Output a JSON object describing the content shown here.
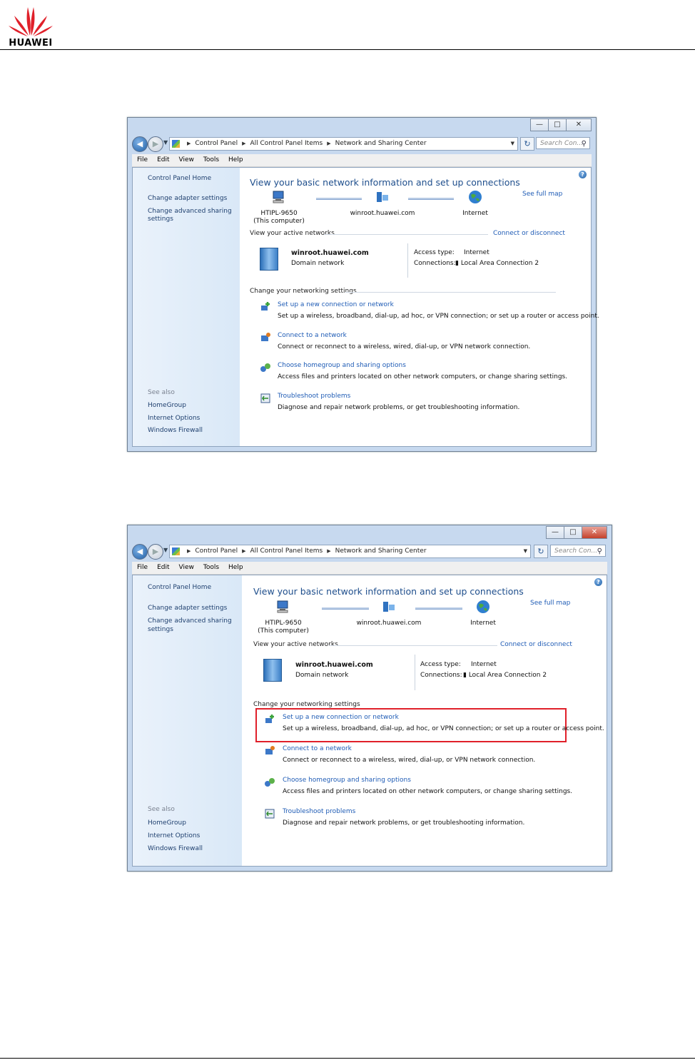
{
  "brand": {
    "name": "HUAWEI",
    "logo_color": "#e0202a"
  },
  "windows": [
    {
      "titlebar": {
        "buttons": [
          "minimize",
          "maximize",
          "close"
        ]
      },
      "address": {
        "crumbs": [
          "Control Panel",
          "All Control Panel Items",
          "Network and Sharing Center"
        ],
        "search_placeholder": "Search Con..."
      },
      "menu": [
        "File",
        "Edit",
        "View",
        "Tools",
        "Help"
      ],
      "sidebar": {
        "home": "Control Panel Home",
        "adapter": "Change adapter settings",
        "sharing_1": "Change advanced sharing",
        "sharing_2": "settings",
        "see_also": "See also",
        "links": [
          "HomeGroup",
          "Internet Options",
          "Windows Firewall"
        ]
      },
      "main": {
        "title": "View your basic network information and set up connections",
        "see_full_map": "See full map",
        "nodes": [
          {
            "name": "HTIPL-9650",
            "sub": "(This computer)",
            "icon": "computer-icon"
          },
          {
            "name": "winroot.huawei.com",
            "sub": "",
            "icon": "domain-icon"
          },
          {
            "name": "Internet",
            "sub": "",
            "icon": "globe-icon"
          }
        ],
        "active_networks_label": "View your active networks",
        "connect_disconnect": "Connect or disconnect",
        "network": {
          "name": "winroot.huawei.com",
          "type": "Domain network",
          "access_label": "Access type:",
          "access_value": "Internet",
          "connections_label": "Connections:",
          "connections_value": "Local Area Connection 2"
        },
        "change_settings_label": "Change your networking settings",
        "tasks": [
          {
            "title": "Set up a new connection or network",
            "desc": "Set up a wireless, broadband, dial-up, ad hoc, or VPN connection; or set up a router or access point."
          },
          {
            "title": "Connect to a network",
            "desc": "Connect or reconnect to a wireless, wired, dial-up, or VPN network connection."
          },
          {
            "title": "Choose homegroup and sharing options",
            "desc": "Access files and printers located on other network computers, or change sharing settings."
          },
          {
            "title": "Troubleshoot problems",
            "desc": "Diagnose and repair network problems, or get troubleshooting information."
          }
        ]
      }
    }
  ],
  "highlight": {
    "color": "#e0202a",
    "target": "Set up a new connection or network"
  }
}
